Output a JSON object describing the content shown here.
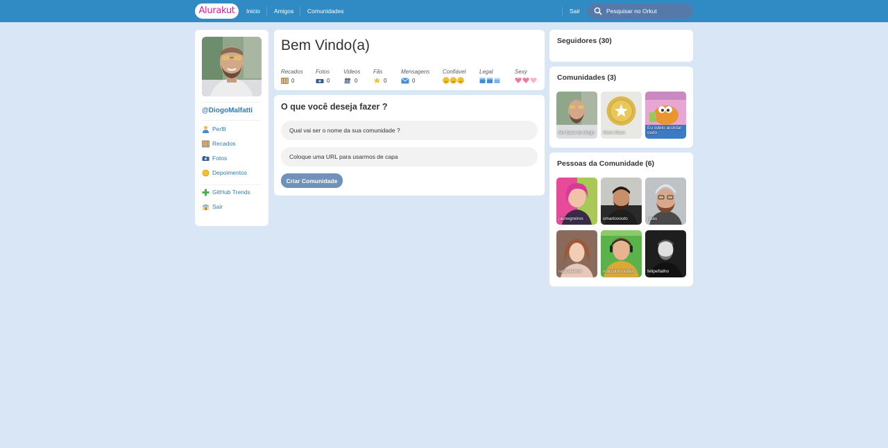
{
  "header": {
    "logo": "Alurakut",
    "nav": [
      {
        "label": "Inicio"
      },
      {
        "label": "Amigos"
      },
      {
        "label": "Comunidades"
      }
    ],
    "logout": "Sair",
    "search_placeholder": "Pesquisar no Orkut"
  },
  "sidebar": {
    "username": "@DiogoMalfatti",
    "items": [
      {
        "label": "Perfil",
        "icon": "user-icon"
      },
      {
        "label": "Recados",
        "icon": "book-icon"
      },
      {
        "label": "Fotos",
        "icon": "camera-icon"
      },
      {
        "label": "Depoimentos",
        "icon": "sun-icon"
      }
    ],
    "extra_items": [
      {
        "label": "GitHub Trends",
        "icon": "plus-icon"
      },
      {
        "label": "Sair",
        "icon": "logout-icon"
      }
    ]
  },
  "welcome": {
    "title": "Bem Vindo(a)",
    "stats": [
      {
        "label": "Recados",
        "value": "0",
        "icon": "book-icon"
      },
      {
        "label": "Fotos",
        "value": "0",
        "icon": "camera-icon"
      },
      {
        "label": "Videos",
        "value": "0",
        "icon": "video-icon"
      },
      {
        "label": "Fãs",
        "value": "0",
        "icon": "star-icon"
      },
      {
        "label": "Mensagens",
        "value": "0",
        "icon": "mail-icon"
      },
      {
        "label": "Confiável",
        "rating": 3,
        "icon": "smile-icon"
      },
      {
        "label": "Legal",
        "rating": 3,
        "icon": "cube-icon"
      },
      {
        "label": "Sexy",
        "rating": 3,
        "icon": "heart-icon"
      }
    ]
  },
  "form": {
    "title": "O que você deseja fazer ?",
    "name_placeholder": "Qual vai ser o nome da sua comunidade ?",
    "url_placeholder": "Coloque uma URL para usarmos de capa",
    "submit": "Criar Comunidade"
  },
  "followers": {
    "title": "Seguidores (30)"
  },
  "communities": {
    "title": "Comunidades (3)",
    "items": [
      {
        "name": "fan base do diogo"
      },
      {
        "name": "Alura Stars"
      },
      {
        "name": "Eu odeio acordar cedo"
      }
    ]
  },
  "people": {
    "title": "Pessoas da Comunidade (6)",
    "items": [
      {
        "name": "juunegreiros"
      },
      {
        "name": "omariosouto"
      },
      {
        "name": "peas"
      },
      {
        "name": "rafaballerini"
      },
      {
        "name": "marcobrunodev"
      },
      {
        "name": "felipefialho"
      }
    ]
  },
  "colors": {
    "topbar": "#308BC5",
    "background": "#D9E6F6",
    "link": "#2E7BB4",
    "logo": "#D81D99",
    "button": "#6F92BB"
  }
}
